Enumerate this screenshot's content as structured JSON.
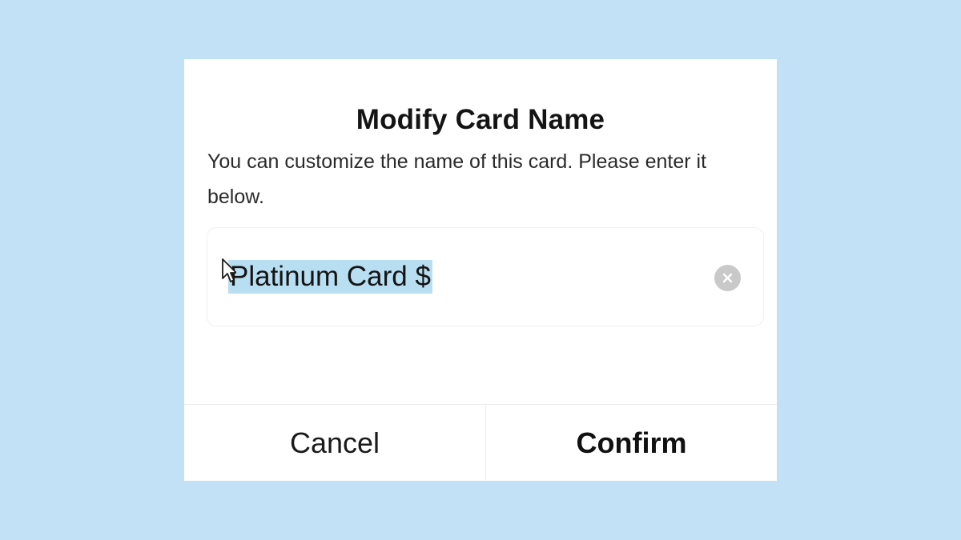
{
  "dialog": {
    "title": "Modify Card Name",
    "description": "You can customize the name of this card. Please enter it below.",
    "input": {
      "value": "Platinum Card $",
      "selected": true,
      "clear_icon": "clear-circle-icon"
    },
    "actions": {
      "cancel_label": "Cancel",
      "confirm_label": "Confirm"
    }
  },
  "colors": {
    "background": "#c2e1f7",
    "dialog": "#ffffff",
    "selection": "#b8def2",
    "clear_icon": "#c9c9c9"
  }
}
